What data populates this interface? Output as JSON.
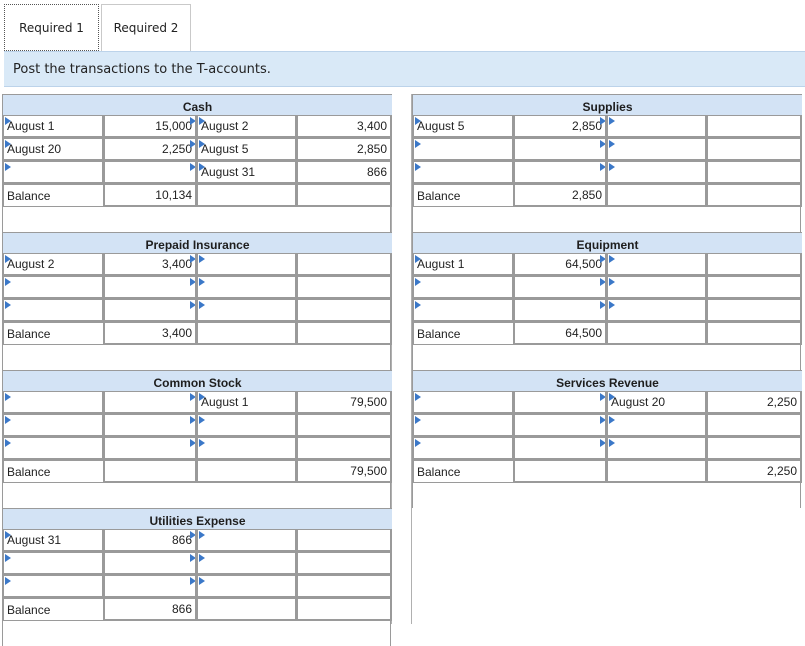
{
  "tabs": [
    {
      "label": "Required 1"
    },
    {
      "label": "Required 2"
    }
  ],
  "instruction": "Post the transactions to the T-accounts.",
  "accounts": [
    {
      "title": "Cash",
      "rows": [
        {
          "dl": "August 1",
          "dv": "15,000",
          "cl": "August 2",
          "cv": "3,400"
        },
        {
          "dl": "August 20",
          "dv": "2,250",
          "cl": "August 5",
          "cv": "2,850"
        },
        {
          "dl": "",
          "dv": "",
          "cl": "August 31",
          "cv": "866"
        }
      ],
      "balance": {
        "label": "Balance",
        "dv": "10,134",
        "cl": "",
        "cv": ""
      }
    },
    {
      "title": "Supplies",
      "rows": [
        {
          "dl": "August 5",
          "dv": "2,850",
          "cl": "",
          "cv": ""
        },
        {
          "dl": "",
          "dv": "",
          "cl": "",
          "cv": ""
        },
        {
          "dl": "",
          "dv": "",
          "cl": "",
          "cv": ""
        }
      ],
      "balance": {
        "label": "Balance",
        "dv": "2,850",
        "cl": "",
        "cv": ""
      }
    },
    {
      "title": "Prepaid Insurance",
      "rows": [
        {
          "dl": "August 2",
          "dv": "3,400",
          "cl": "",
          "cv": ""
        },
        {
          "dl": "",
          "dv": "",
          "cl": "",
          "cv": ""
        },
        {
          "dl": "",
          "dv": "",
          "cl": "",
          "cv": ""
        }
      ],
      "balance": {
        "label": "Balance",
        "dv": "3,400",
        "cl": "",
        "cv": ""
      }
    },
    {
      "title": "Equipment",
      "rows": [
        {
          "dl": "August 1",
          "dv": "64,500",
          "cl": "",
          "cv": ""
        },
        {
          "dl": "",
          "dv": "",
          "cl": "",
          "cv": ""
        },
        {
          "dl": "",
          "dv": "",
          "cl": "",
          "cv": ""
        }
      ],
      "balance": {
        "label": "Balance",
        "dv": "64,500",
        "cl": "",
        "cv": ""
      }
    },
    {
      "title": "Common Stock",
      "rows": [
        {
          "dl": "",
          "dv": "",
          "cl": "August 1",
          "cv": "79,500"
        },
        {
          "dl": "",
          "dv": "",
          "cl": "",
          "cv": ""
        },
        {
          "dl": "",
          "dv": "",
          "cl": "",
          "cv": ""
        }
      ],
      "balance": {
        "label": "Balance",
        "dv": "",
        "cl": "",
        "cv": "79,500"
      }
    },
    {
      "title": "Services Revenue",
      "rows": [
        {
          "dl": "",
          "dv": "",
          "cl": "August 20",
          "cv": "2,250"
        },
        {
          "dl": "",
          "dv": "",
          "cl": "",
          "cv": ""
        },
        {
          "dl": "",
          "dv": "",
          "cl": "",
          "cv": ""
        }
      ],
      "balance": {
        "label": "Balance",
        "dv": "",
        "cl": "",
        "cv": "2,250"
      }
    },
    {
      "title": "Utilities Expense",
      "rows": [
        {
          "dl": "August 31",
          "dv": "866",
          "cl": "",
          "cv": ""
        },
        {
          "dl": "",
          "dv": "",
          "cl": "",
          "cv": ""
        },
        {
          "dl": "",
          "dv": "",
          "cl": "",
          "cv": ""
        }
      ],
      "balance": {
        "label": "Balance",
        "dv": "866",
        "cl": "",
        "cv": ""
      }
    }
  ]
}
